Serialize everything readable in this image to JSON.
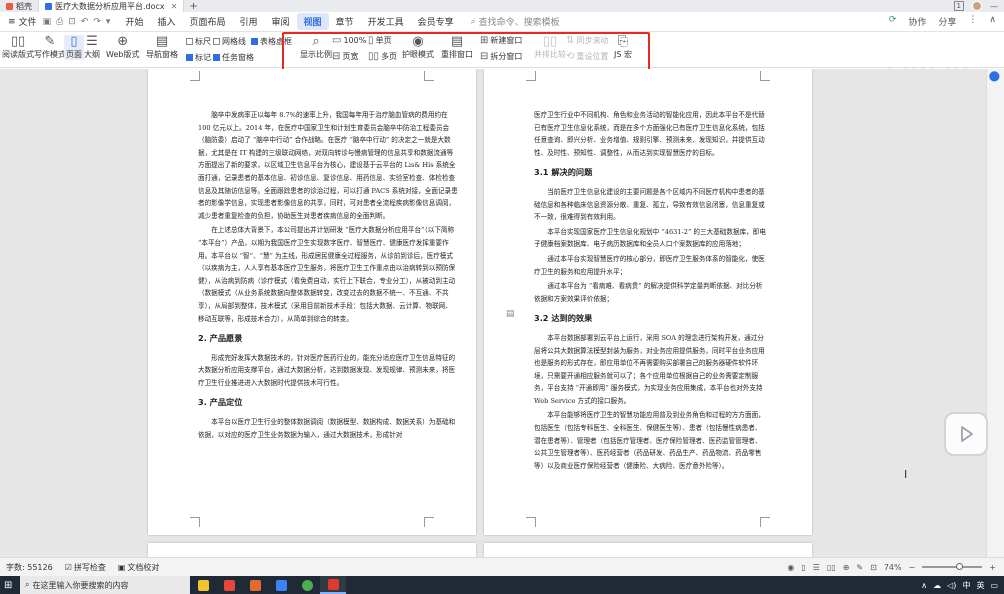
{
  "tabs": [
    {
      "label": "稻壳",
      "color": "#e85d3f",
      "active": false
    },
    {
      "label": "医疗大数据分析应用平台.docx",
      "color": "#2f6fe0",
      "active": true
    }
  ],
  "titlebar_right": {
    "window_num": "1"
  },
  "menu": {
    "file": "文件",
    "items": [
      "开始",
      "插入",
      "页面布局",
      "引用",
      "审阅",
      "视图",
      "章节",
      "开发工具",
      "会员专享"
    ],
    "active": "视图",
    "search": "查找命令、搜索模板",
    "right": [
      "协作",
      "分享"
    ]
  },
  "ribbon": {
    "left_buttons": [
      "阅读版式",
      "写作模式",
      "页面",
      "大纲",
      "Web版式",
      "导航窗格"
    ],
    "checkboxes": [
      {
        "label": "标尺",
        "checked": false
      },
      {
        "label": "网格线",
        "checked": false
      },
      {
        "label": "表格虚框",
        "checked": true
      },
      {
        "label": "标记",
        "checked": true
      },
      {
        "label": "任务窗格",
        "checked": true
      }
    ],
    "zoom_button": "显示比例",
    "percent": "100%",
    "single_page": "单页",
    "page_width": "页宽",
    "multi_page": "多页",
    "eye_mode": "护眼模式",
    "rearrange": "重排窗口",
    "new_window": "新建窗口",
    "split_window": "拆分窗口",
    "side_compare": "并排比较",
    "sync_scroll": "同步滚动",
    "reset_position": "重设位置",
    "js_macro": "JS 宏",
    "watermark": "bilibili"
  },
  "doc_left": {
    "paragraphs": [
      "脑卒中发病率正以每年 8.7%的速率上升，我国每年用于治疗脑血管病的费用约在 100 亿元以上。2014 年，在医疗中国家卫生和计划生育委员会脑卒中防治工程委员会（脑防委）启动了 “脑卒中行动” 合作战略。在医疗 “脑卒中行动” 的决定之一就是大数据，尤其是在 IT 构建的三级联动网络，对双向转诊与慢病管理的信息共享和数据流通等方面提出了新的要求，以区域卫生信息平台为核心，建设基于云平台的 Lis& His 系统全面打通，记录患者的基本信息、初诊信息、复诊信息、用药信息、实验室检查、体检检查信息及其随访信息等。全面跟踪患者的诊治过程，可以打通 PACS 系统对接，全面记录患者的影像学信息，实现患者影像信息的共享，同时，可对患者全流程疾病影像信息调阅，减少患者重复检查的负担，协助医生对患者疾病信息的全面判断。",
      "在上述总体大背景下，本公司提出并计划研发 “医疗大数据分析应用平台”（以下简称 “本平台”）产品，以期为我国医疗卫生实现数字医疗、智慧医疗、健康医疗发挥重要作用。本平台以 “智”、“慧” 为主线，形成居民健康全过程服务，从诊前到诊后，医疗模式（以疾病为主，人人享有基本医疗卫生服务，将医疗卫生工作重点由以治病转到以预防保健），从治病到防病（诊疗模式（看免费自动，实行上下联合，专业分工），从被动到主动（数据模式（从业务系统数据向整体数据转变，改变过去的数据不统一、不互通、不共享），从局部到整体，技术模式（采用目前新技术手段：包括大数据、云计算、物联网、移动互联等，形成技术合力），从简单到综合的转变。"
    ],
    "section2_title": "2. 产品愿景",
    "section2_body": "形成完好发挥大数据技术的，针对医疗医药行业的，能充分适应医疗卫生信息特征的大数据分析应用支撑平台，通过大数据分析，达到数据发现、发现规律、预测未来，将医疗卫生行业推进进入大数据时代提供技术可行性。",
    "section3_title": "3. 产品定位",
    "section3_body": "本平台以医疗卫生行业的整体数据调阅（数据模型、数据构成、数据关系）为基础和依据，以对应的医疗卫生业务数据为输入，通过大数据技术，形成针对"
  },
  "doc_right": {
    "intro": "医疗卫生行业中不同机构、角色和业务活动的智能化应用，因此本平台不是代替已有医疗卫生信息化系统，而是在多个方面强化已有医疗卫生信息化系统，包括任意查询、即兴分析、业务增值、规则引擎、预测未来、发现知识，并提供互动性、及时性、预知性、调整性，从而达到实现智慧医疗的目标。",
    "sec31_title": "3.1 解决的问题",
    "sec31_paras": [
      "当前医疗卫生信息化建设的主要问题是各个区域内不同医疗机构中患者的基础信息和各种临床信息资源分散、重复、孤立，导致有效信息闭塞，信息重复或不一致，很难得到有效利用。",
      "本平台实现国家医疗卫生信息化规划中 “4631-2” 的三大基础数据库，即电子健康档案数据库、电子病历数据库和全员人口个案数据库的应用落地；",
      "通过本平台实现智慧医疗的核心部分，即医疗卫生服务体系的智能化，使医疗卫生的服务和应用提升水平；",
      "通过本平台为 “看病难、看病贵” 的解决提供科学定量判断依据、对比分析依据和方案效果评价依据；"
    ],
    "sec32_title": "3.2 达到的效果",
    "sec32_paras": [
      "本平台数据部署到云平台上运行，采用 SOA 的理念进行架构开发，通过分层将公共大数据算法模型封装为服务，对业务应用提供服务，同时平台业务应用也是服务的形式存在，即应用单位不再需要购买部署自己的服务器硬件软件环境，只需要开通相应服务就可以了；各个应用单位根据自己的业务需要定制服务，平台支持 “开通即用” 服务模式，为实现业务应用集成，本平台也对外支持 Web Service 方式的接口服务。",
      "本平台能够将医疗卫生的智慧功能应用普及到业务角色和过程的方方面面，包括医生（包括专科医生、全科医生、保健医生等）、患者（包括慢性病患者、潜在患者等）、管理者（包括医疗管理者、医疗保险管理者、医药监管管理者、公共卫生管理者等）、医药经营者（药品研发、药品生产、药品物流、药品零售等）以及商业医疗保险经营者（健康险、大病险、医疗意外险等）。"
    ]
  },
  "status": {
    "word_count": "字数: 55126",
    "spell_check": "拼写检查",
    "doc_proof": "文档校对",
    "zoom": "74%"
  },
  "taskbar": {
    "search_placeholder": "在这里输入你要搜索的内容",
    "apps": [
      {
        "name": "file-explorer",
        "color": "#f2c230"
      },
      {
        "name": "wps-spreadsheet",
        "color": "#e5473b"
      },
      {
        "name": "wps-presentation",
        "color": "#e56a2e"
      },
      {
        "name": "media-player",
        "color": "#3b82f6"
      },
      {
        "name": "chrome",
        "color": "#4caf50"
      },
      {
        "name": "wps-writer",
        "color": "#e03a2f"
      }
    ],
    "ime": "中",
    "lang": "英"
  }
}
